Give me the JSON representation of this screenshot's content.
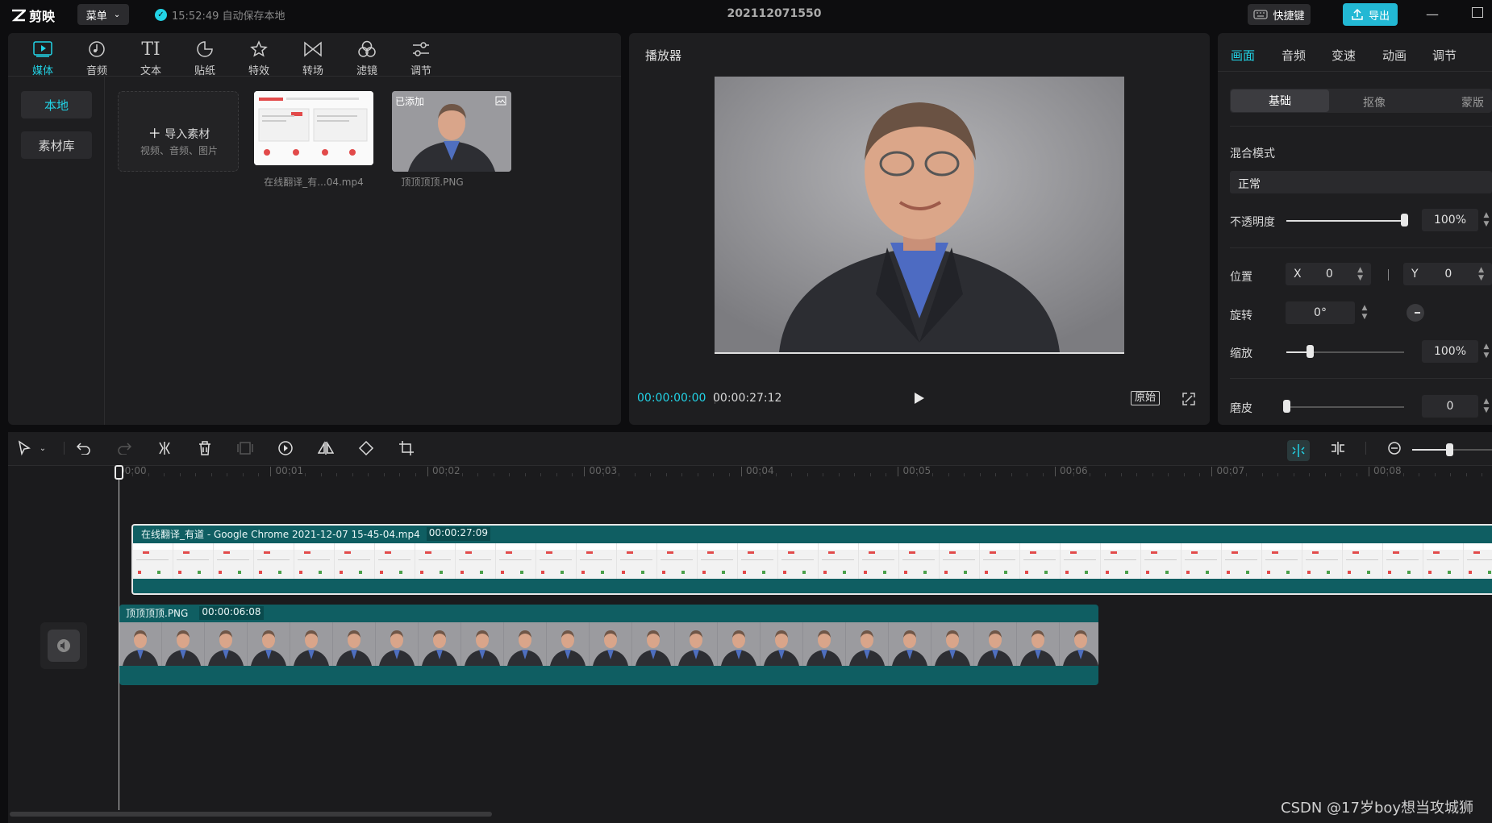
{
  "app": {
    "logo": "剪映",
    "menu_label": "菜单",
    "autosave": "15:52:49 自动保存本地",
    "project_title": "202112071550",
    "shortcut_label": "快捷键",
    "export_label": "导出"
  },
  "toolbar": {
    "items": [
      {
        "label": "媒体",
        "icon": "media-icon",
        "active": true
      },
      {
        "label": "音频",
        "icon": "audio-icon"
      },
      {
        "label": "文本",
        "icon": "text-icon"
      },
      {
        "label": "贴纸",
        "icon": "sticker-icon"
      },
      {
        "label": "特效",
        "icon": "effects-icon"
      },
      {
        "label": "转场",
        "icon": "transition-icon"
      },
      {
        "label": "滤镜",
        "icon": "filter-icon"
      },
      {
        "label": "调节",
        "icon": "adjust-icon"
      }
    ]
  },
  "media": {
    "side": {
      "local": "本地",
      "library": "素材库"
    },
    "import_label": "导入素材",
    "import_hint": "视频、音频、图片",
    "files": [
      {
        "name": "在线翻译_有...04.mp4"
      },
      {
        "name": "顶顶顶顶.PNG",
        "badge": "已添加"
      }
    ]
  },
  "player": {
    "title": "播放器",
    "current_time": "00:00:00:00",
    "total_time": "00:00:27:12",
    "ratio_label": "原始"
  },
  "props": {
    "tabs": [
      "画面",
      "音频",
      "变速",
      "动画",
      "调节"
    ],
    "subtabs": [
      "基础",
      "抠像",
      "蒙版"
    ],
    "blend_label": "混合模式",
    "blend_value": "正常",
    "opacity_label": "不透明度",
    "opacity_value": "100%",
    "opacity_level": 1.0,
    "position_label": "位置",
    "pos_x_label": "X",
    "pos_x": "0",
    "pos_y_label": "Y",
    "pos_y": "0",
    "rotate_label": "旋转",
    "rotate_value": "0°",
    "scale_label": "缩放",
    "scale_value": "100%",
    "scale_level": 0.2,
    "smooth_label": "磨皮",
    "smooth_value": "0",
    "smooth_level": 0
  },
  "timeline": {
    "ticks": [
      "00:00",
      "00:01",
      "00:02",
      "00:03",
      "00:04",
      "00:05",
      "00:06",
      "00:07",
      "00:08"
    ],
    "video_clip": {
      "name": "在线翻译_有道 - Google Chrome 2021-12-07 15-45-04.mp4",
      "duration": "00:00:27:09"
    },
    "image_clip": {
      "name": "顶顶顶顶.PNG",
      "duration": "00:00:06:08"
    }
  },
  "watermark": "CSDN @17岁boy想当攻城狮",
  "colors": {
    "accent": "#22d3e6",
    "clip_teal": "#0f5e62"
  }
}
